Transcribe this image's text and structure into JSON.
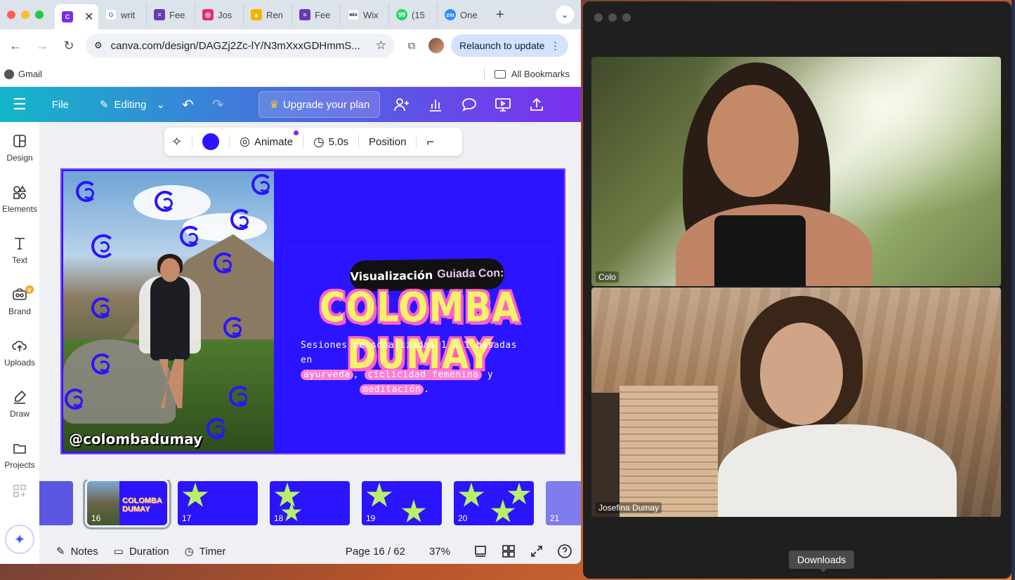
{
  "browser": {
    "tabs": [
      {
        "label": "",
        "favicon": "canva",
        "color": "#7d2ae8"
      },
      {
        "label": "writ",
        "favicon": "google",
        "color": "#4285f4"
      },
      {
        "label": "Fee",
        "favicon": "forms",
        "color": "#673ab7"
      },
      {
        "label": "Jos",
        "favicon": "instagram",
        "color": "#e1306c"
      },
      {
        "label": "Ren",
        "favicon": "book",
        "color": "#f4b400"
      },
      {
        "label": "Fee",
        "favicon": "forms",
        "color": "#673ab7"
      },
      {
        "label": "Wix",
        "favicon": "wix",
        "color": "#111111"
      },
      {
        "label": "(15",
        "favicon": "whatsapp",
        "color": "#25d366"
      },
      {
        "label": "One",
        "favicon": "zoom",
        "color": "#2d8cff"
      }
    ],
    "url": "canva.com/design/DAGZj2Zc-lY/N3mXxxGDHmmS...",
    "relaunch_label": "Relaunch to update",
    "bookmarks": {
      "gmail": "Gmail",
      "all": "All Bookmarks"
    }
  },
  "canva": {
    "top": {
      "file": "File",
      "editing": "Editing",
      "upgrade": "Upgrade your plan"
    },
    "sidebar": [
      {
        "label": "Design",
        "icon": "design-icon"
      },
      {
        "label": "Elements",
        "icon": "elements-icon"
      },
      {
        "label": "Text",
        "icon": "text-icon"
      },
      {
        "label": "Brand",
        "icon": "brand-icon"
      },
      {
        "label": "Uploads",
        "icon": "uploads-icon"
      },
      {
        "label": "Draw",
        "icon": "draw-icon"
      },
      {
        "label": "Projects",
        "icon": "projects-icon"
      }
    ],
    "toolbar": {
      "animate": "Animate",
      "duration": "5.0s",
      "position": "Position",
      "color": "#2b14ff"
    },
    "slide": {
      "handle": "@colombadumay",
      "pill_a": "Visualización",
      "pill_b": "Guiada Con:",
      "title": "COLOMBA DUMAY",
      "subtitle_1": "Sesiones personalizadas 1 a 1 basadas en",
      "hl_1": "ayurveda",
      "hl_2": "ciclicidad femenina",
      "subtitle_2": "y",
      "hl_3": "meditación",
      "subtitle_end": "."
    },
    "thumbnails": [
      {
        "num": "",
        "kind": "partial"
      },
      {
        "num": "16",
        "kind": "selected"
      },
      {
        "num": "17",
        "kind": "star1"
      },
      {
        "num": "18",
        "kind": "star2"
      },
      {
        "num": "19",
        "kind": "star2b"
      },
      {
        "num": "20",
        "kind": "star3"
      },
      {
        "num": "21",
        "kind": "partial"
      }
    ],
    "bottom": {
      "notes": "Notes",
      "duration": "Duration",
      "timer": "Timer",
      "page": "Page 16 / 62",
      "zoom": "37%"
    }
  },
  "zoom": {
    "participants": [
      {
        "name": "Colo"
      },
      {
        "name": "Josefina Dumay"
      }
    ],
    "tooltip": "Downloads"
  }
}
